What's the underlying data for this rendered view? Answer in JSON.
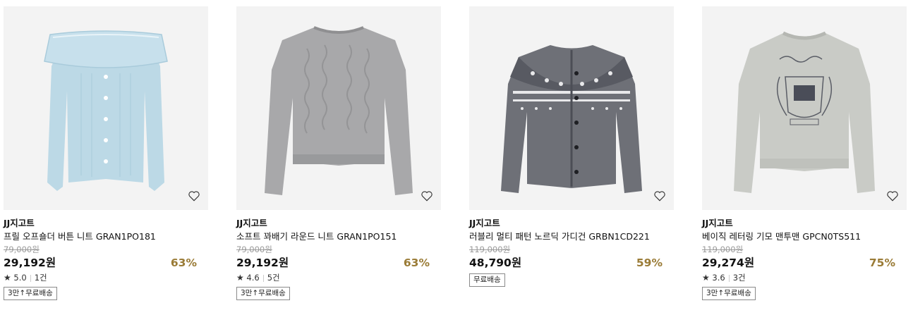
{
  "products": [
    {
      "brand": "JJ지고트",
      "name": "프릴 오프숄더 버튼 니트 GRAN1PO181",
      "original_price": "79,000원",
      "price": "29,192원",
      "discount": "63%",
      "rating": "5.0",
      "review_count": "1건",
      "shipping_badge": "3만↑무료배송",
      "image_colors": {
        "body": "#bcd9e6",
        "trim": "#a9cbdb"
      }
    },
    {
      "brand": "JJ지고트",
      "name": "소프트 꽈배기 라운드 니트 GRAN1PO151",
      "original_price": "79,000원",
      "price": "29,192원",
      "discount": "63%",
      "rating": "4.6",
      "review_count": "5건",
      "shipping_badge": "3만↑무료배송",
      "image_colors": {
        "body": "#a8a8aa",
        "trim": "#8f8f91"
      }
    },
    {
      "brand": "JJ지고트",
      "name": "러블리 멀티 패턴 노르딕 가디건 GRBN1CD221",
      "original_price": "119,000원",
      "price": "48,790원",
      "discount": "59%",
      "shipping_badge": "무료배송",
      "image_colors": {
        "body": "#6e7077",
        "trim": "#4c4e56"
      }
    },
    {
      "brand": "JJ지고트",
      "name": "베이직 레터링 기모 맨투맨 GPCN0TS511",
      "original_price": "119,000원",
      "price": "29,274원",
      "discount": "75%",
      "rating": "3.6",
      "review_count": "3건",
      "shipping_badge": "3만↑무료배송",
      "image_colors": {
        "body": "#c9cbc6",
        "trim": "#b5b7b2"
      }
    }
  ],
  "icons": {
    "wishlist": "heart-outline-icon",
    "rating": "star-icon"
  },
  "colors": {
    "discount": "#9a7b36",
    "image_bg": "#f3f3f3"
  }
}
